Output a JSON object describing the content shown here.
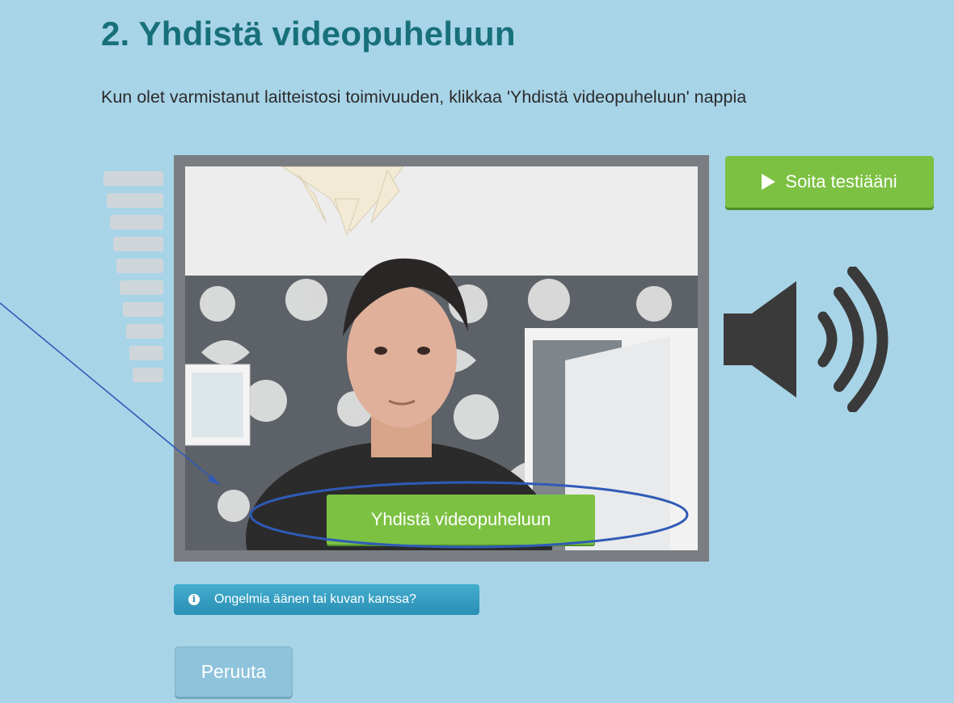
{
  "page": {
    "title": "2. Yhdistä videopuheluun",
    "instruction": "Kun olet varmistanut laitteistosi toimivuuden, klikkaa 'Yhdistä videopuheluun' nappia"
  },
  "video": {
    "connect_label": "Yhdistä videopuheluun"
  },
  "audio": {
    "play_test_label": "Soita testiääni",
    "speaker_icon": "speaker-volume-icon",
    "level_meter_bars": 10
  },
  "help": {
    "label": "Ongelmia äänen tai kuvan kanssa?",
    "icon": "info-icon"
  },
  "actions": {
    "cancel_label": "Peruuta"
  },
  "colors": {
    "background": "#a8d4e8",
    "title": "#17707a",
    "green_button": "#7cc142",
    "help_button": "#2a8fb4",
    "annotation": "#2f5bb7"
  }
}
